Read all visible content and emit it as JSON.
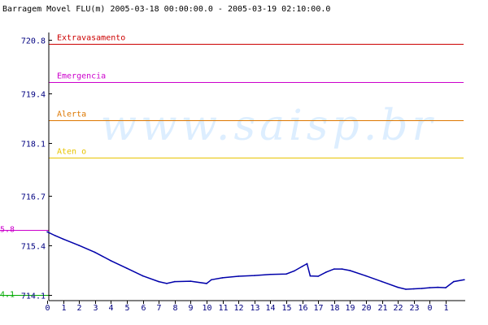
{
  "chart_data": {
    "type": "line",
    "title": "Barragem Movel FLU(m) 2005-03-18 00:00:00.0 - 2005-03-19 02:10:00.0",
    "watermark": "www.saisp.br",
    "xlabel": "",
    "ylabel": "",
    "y_ticks": [
      "720.8",
      "719.4",
      "718.1",
      "716.7",
      "715.4",
      "714.1"
    ],
    "y_tick_values": [
      720.8,
      719.4,
      718.1,
      716.7,
      715.4,
      714.1
    ],
    "ylim": [
      713.95,
      721.0
    ],
    "x_ticks": [
      "0",
      "1",
      "2",
      "3",
      "4",
      "5",
      "6",
      "7",
      "8",
      "9",
      "10",
      "11",
      "12",
      "13",
      "14",
      "15",
      "16",
      "17",
      "18",
      "19",
      "20",
      "21",
      "22",
      "23",
      "0",
      "1"
    ],
    "xlim": [
      0,
      26.17
    ],
    "x_unit": "hours since 2005-03-18 00:00",
    "levels": [
      {
        "name": "Extravasamento",
        "value": 720.7,
        "color": "#cc0000"
      },
      {
        "name": "Emergencia",
        "value": 719.7,
        "color": "#cc00cc"
      },
      {
        "name": "Alerta",
        "value": 718.7,
        "color": "#dd7700"
      },
      {
        "name": "Aten  o",
        "value": 717.7,
        "color": "#e8c400"
      }
    ],
    "markers": [
      {
        "label": "5.8",
        "value": 715.8,
        "color": "#cc00cc"
      },
      {
        "label": "4.1",
        "value": 714.1,
        "color": "#00aa00"
      }
    ],
    "series": [
      {
        "color": "#0000aa",
        "x": [
          0,
          0.5,
          1,
          2,
          3,
          4,
          5,
          6,
          7,
          7.5,
          8,
          9,
          10,
          10.3,
          11,
          12,
          13,
          14,
          15,
          15.5,
          16,
          16.3,
          16.5,
          17,
          17.5,
          18,
          18.5,
          19,
          20,
          21,
          22,
          22.5,
          23,
          23.5,
          24,
          24.5,
          25,
          25.5,
          26.17
        ],
        "values": [
          715.76,
          715.66,
          715.57,
          715.4,
          715.22,
          715.0,
          714.8,
          714.6,
          714.45,
          714.4,
          714.45,
          714.46,
          714.4,
          714.5,
          714.55,
          714.59,
          714.61,
          714.64,
          714.65,
          714.73,
          714.85,
          714.92,
          714.6,
          714.59,
          714.7,
          714.78,
          714.78,
          714.74,
          714.6,
          714.45,
          714.3,
          714.25,
          714.26,
          714.27,
          714.29,
          714.3,
          714.29,
          714.45,
          714.5
        ]
      }
    ],
    "grid": false,
    "legend": "none"
  }
}
